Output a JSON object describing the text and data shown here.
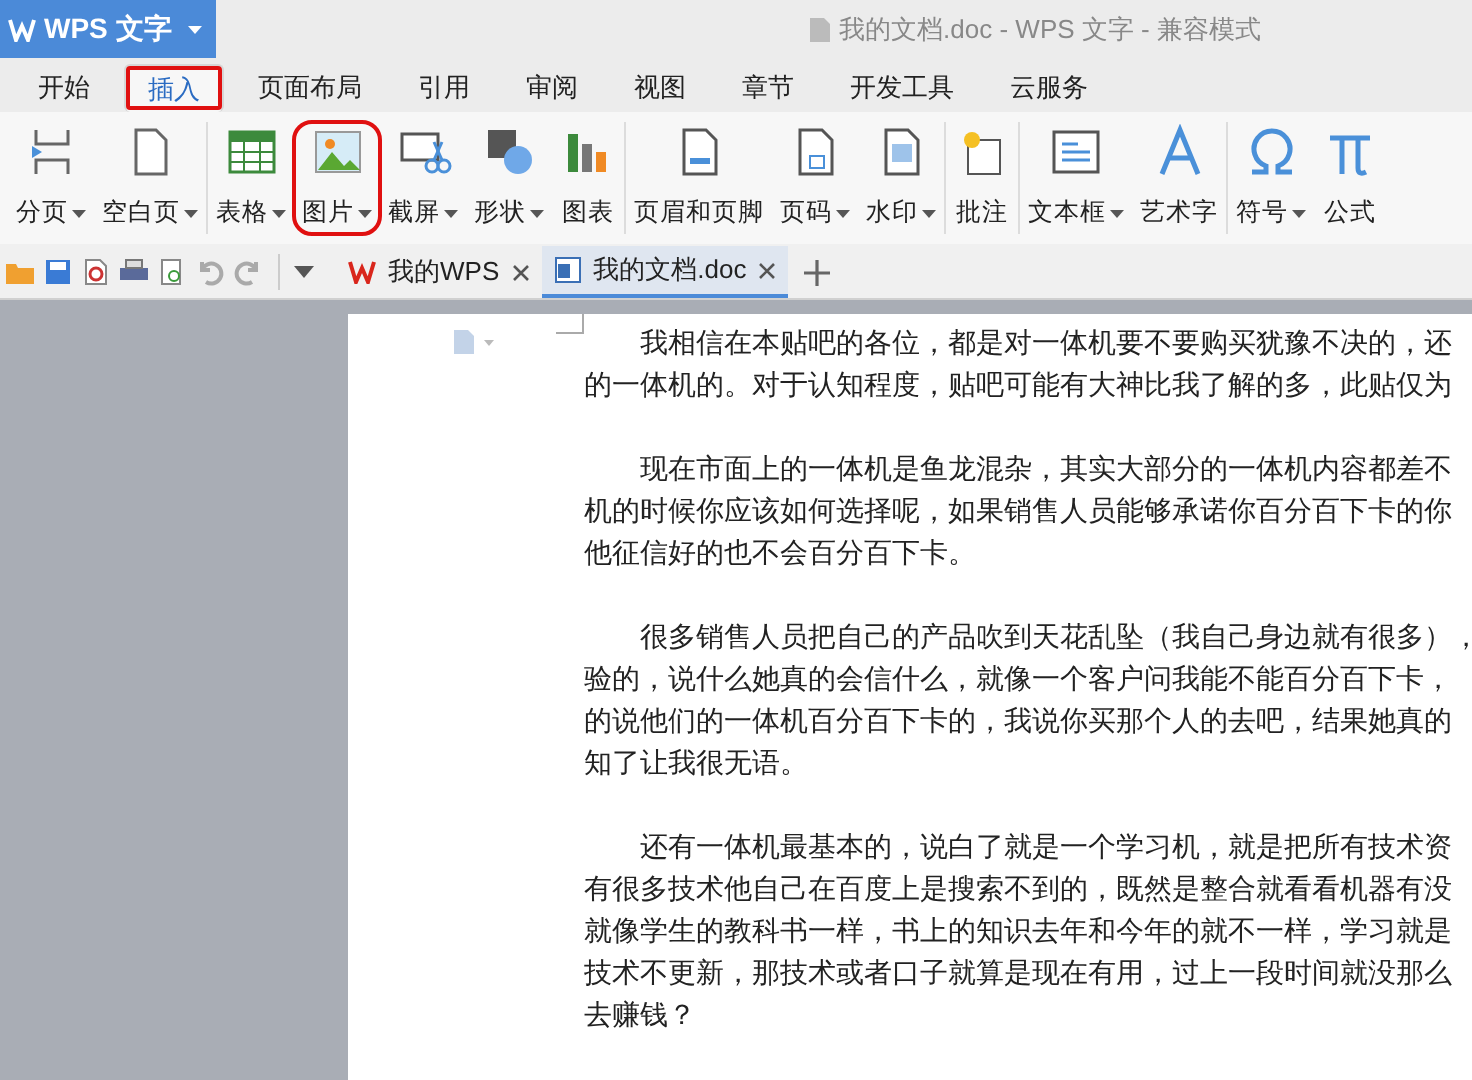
{
  "app_button": {
    "label": "WPS 文字"
  },
  "window": {
    "title": "我的文档.doc - WPS 文字 - 兼容模式"
  },
  "tabs": [
    {
      "label": "开始",
      "selected": false,
      "circled": false
    },
    {
      "label": "插入",
      "selected": true,
      "circled": true
    },
    {
      "label": "页面布局",
      "selected": false,
      "circled": false
    },
    {
      "label": "引用",
      "selected": false,
      "circled": false
    },
    {
      "label": "审阅",
      "selected": false,
      "circled": false
    },
    {
      "label": "视图",
      "selected": false,
      "circled": false
    },
    {
      "label": "章节",
      "selected": false,
      "circled": false
    },
    {
      "label": "开发工具",
      "selected": false,
      "circled": false
    },
    {
      "label": "云服务",
      "selected": false,
      "circled": false
    }
  ],
  "ribbon_groups": [
    [
      {
        "label": "分页",
        "dropdown": true,
        "circled": false
      },
      {
        "label": "空白页",
        "dropdown": true,
        "circled": false
      }
    ],
    [
      {
        "label": "表格",
        "dropdown": true,
        "circled": false
      },
      {
        "label": "图片",
        "dropdown": true,
        "circled": true
      },
      {
        "label": "截屏",
        "dropdown": true,
        "circled": false
      },
      {
        "label": "形状",
        "dropdown": true,
        "circled": false
      },
      {
        "label": "图表",
        "dropdown": false,
        "circled": false
      }
    ],
    [
      {
        "label": "页眉和页脚",
        "dropdown": false,
        "circled": false
      },
      {
        "label": "页码",
        "dropdown": true,
        "circled": false
      },
      {
        "label": "水印",
        "dropdown": true,
        "circled": false
      }
    ],
    [
      {
        "label": "批注",
        "dropdown": false,
        "circled": false
      }
    ],
    [
      {
        "label": "文本框",
        "dropdown": true,
        "circled": false
      },
      {
        "label": "艺术字",
        "dropdown": false,
        "circled": false
      }
    ],
    [
      {
        "label": "符号",
        "dropdown": true,
        "circled": false
      },
      {
        "label": "公式",
        "dropdown": false,
        "circled": false
      }
    ]
  ],
  "doc_tabs": [
    {
      "label": "我的WPS",
      "selected": false
    },
    {
      "label": "我的文档.doc",
      "selected": true
    }
  ],
  "paragraphs": [
    [
      "我相信在本贴吧的各位，都是对一体机要不要购买犹豫不决的，还",
      "的一体机的。对于认知程度，贴吧可能有大神比我了解的多，此贴仅为"
    ],
    [
      "现在市面上的一体机是鱼龙混杂，其实大部分的一体机内容都差不",
      "机的时候你应该如何选择呢，如果销售人员能够承诺你百分百下卡的你",
      "他征信好的也不会百分百下卡。"
    ],
    [
      "很多销售人员把自己的产品吹到天花乱坠（我自己身边就有很多），",
      "验的，说什么她真的会信什么，就像一个客户问我能不能百分百下卡，",
      "的说他们的一体机百分百下卡的，我说你买那个人的去吧，结果她真的",
      "知了让我很无语。"
    ],
    [
      "还有一体机最基本的，说白了就是一个学习机，就是把所有技术资",
      "有很多技术他自己在百度上是搜索不到的，既然是整合就看看机器有没",
      "就像学生的教科书一样，书上的知识去年和今年的就不一样，学习就是",
      "技术不更新，那技术或者口子就算是现在有用，过上一段时间就没那么",
      "去赚钱？"
    ]
  ]
}
